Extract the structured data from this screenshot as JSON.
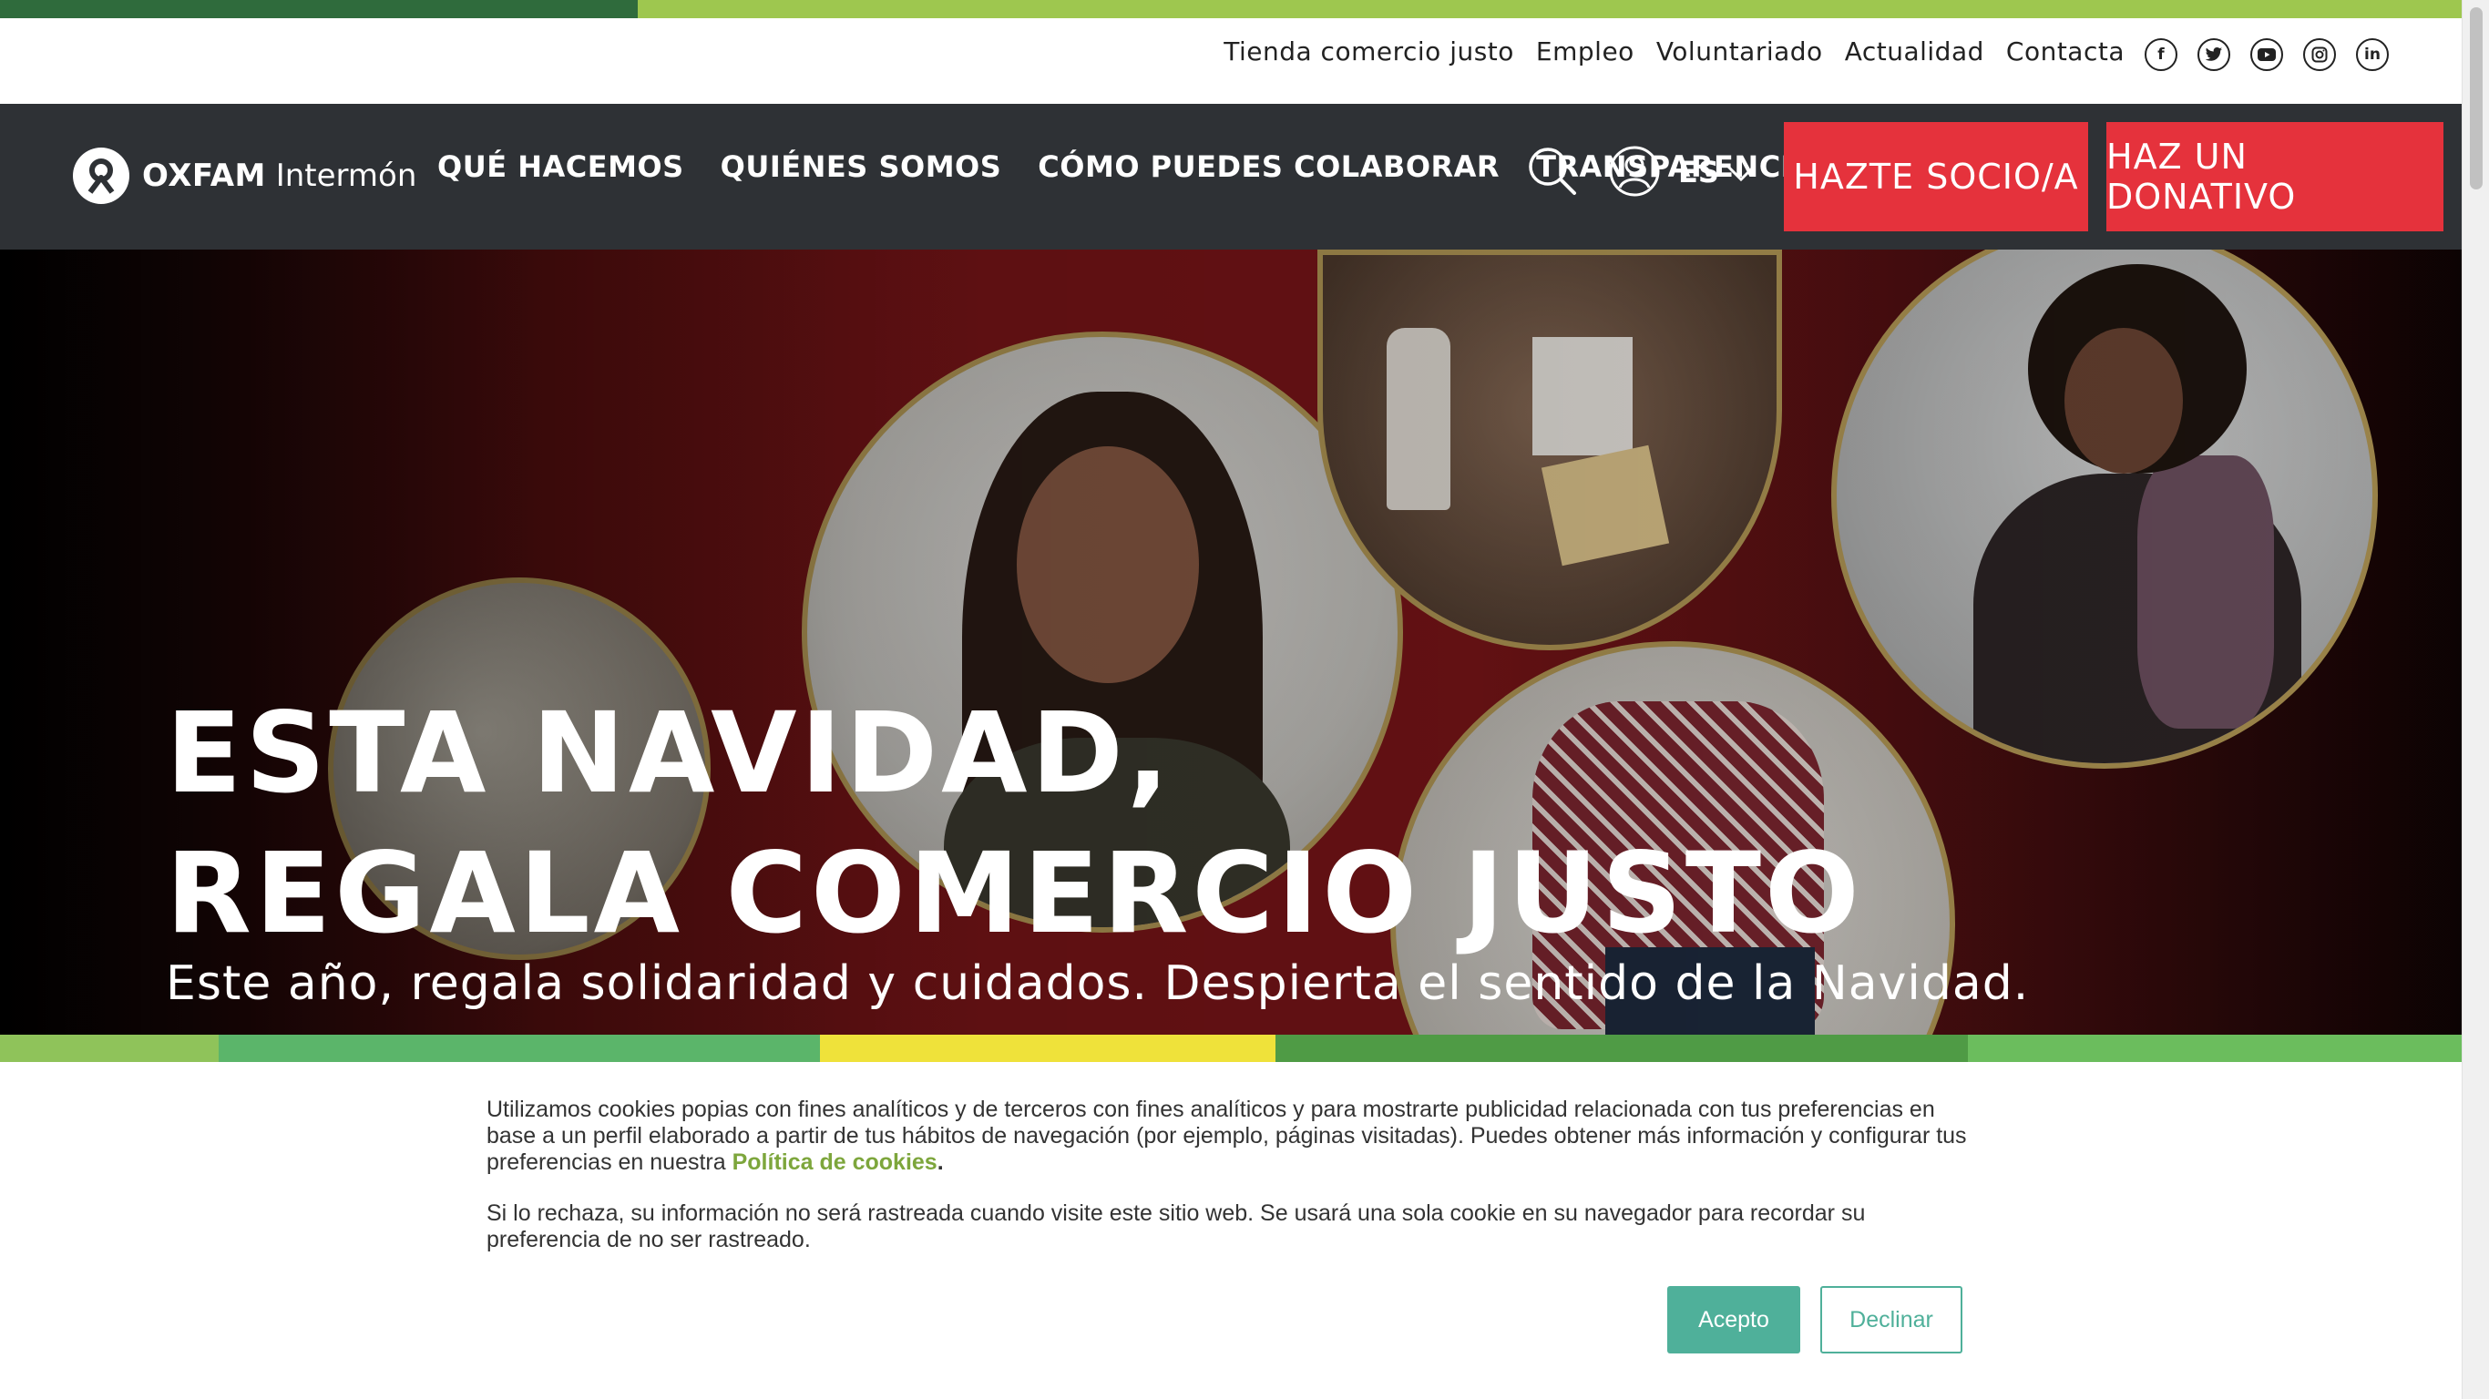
{
  "utility": {
    "links": [
      "Tienda comercio justo",
      "Empleo",
      "Voluntariado",
      "Actualidad",
      "Contacta"
    ],
    "social": [
      "facebook-icon",
      "twitter-icon",
      "youtube-icon",
      "instagram-icon",
      "linkedin-icon"
    ]
  },
  "brand": {
    "name_bold": "OXFAM",
    "name_light": "Intermón"
  },
  "nav": {
    "items": [
      "QUÉ HACEMOS",
      "QUIÉNES SOMOS",
      "CÓMO PUEDES COLABORAR",
      "TRANSPARENCIA"
    ],
    "lang": "ES",
    "cta_socio": "HAZTE SOCIO/A",
    "cta_donativo": "HAZ UN DONATIVO"
  },
  "hero": {
    "title_line1": "ESTA NAVIDAD,",
    "title_line2": "REGALA COMERCIO JUSTO",
    "subtitle": "Este año, regala solidaridad y cuidados. Despierta el sentido de la Navidad."
  },
  "cookie": {
    "p1_before": "Utilizamos cookies popias con fines analíticos y de terceros con fines analíticos y para mostrarte publicidad relacionada con tus preferencias en base a un perfil elaborado a partir de tus hábitos de navegación (por ejemplo, páginas visitadas). Puedes obtener más información y configurar tus preferencias en nuestra ",
    "policy_link": "Política de cookies",
    "p1_after": ".",
    "p2": "Si lo rechaza, su información no será rastreada cuando visite este sitio web. Se usará una sola cookie en su navegador para recordar su preferencia de no ser rastreado.",
    "accept": "Acepto",
    "decline": "Declinar"
  },
  "colors": {
    "nav_bg": "#2e3135",
    "cta_red": "#e5323c",
    "accept_teal": "#4fb09a",
    "link_green": "#7da63c"
  }
}
